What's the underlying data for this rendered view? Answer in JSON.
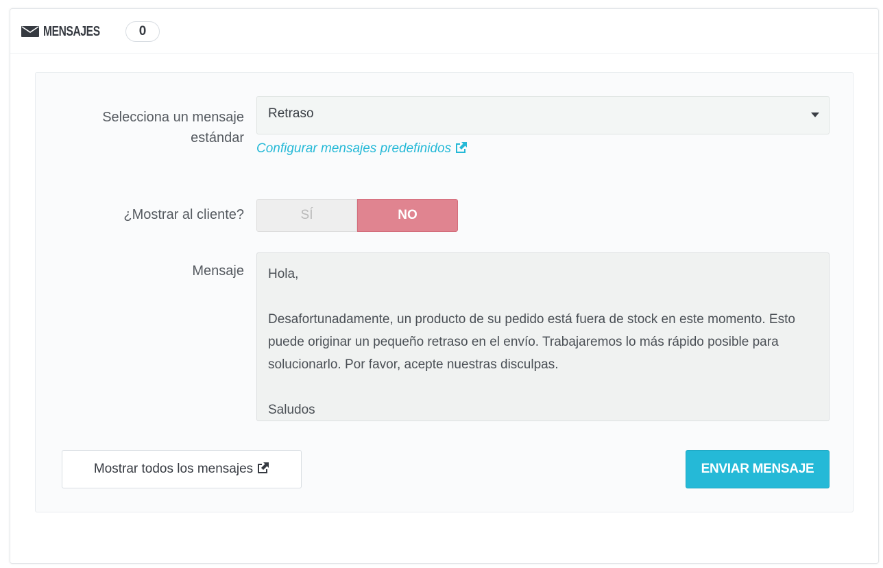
{
  "panel": {
    "title": "MENSAJES",
    "count": "0"
  },
  "form": {
    "select_label": "Selecciona un mensaje estándar",
    "select_value": "Retraso",
    "config_link": "Configurar mensajes predefinidos",
    "show_label": "¿Mostrar al cliente?",
    "toggle_yes": "SÍ",
    "toggle_no": "NO",
    "toggle_selected": "NO",
    "message_label": "Mensaje",
    "message_text": "Hola,\n\nDesafortunadamente, un producto de su pedido está fuera de stock en este momento. Esto puede originar un pequeño retraso en el envío. Trabajaremos lo más rápido posible para solucionarlo. Por favor, acepte nuestras disculpas.\n\nSaludos"
  },
  "actions": {
    "show_all": "Mostrar todos los mensajes",
    "send": "ENVIAR MENSAJE"
  },
  "colors": {
    "accent": "#25b9d7",
    "toggle_no": "#e08490"
  },
  "icons": {
    "heading": "envelope-icon",
    "external": "external-link-icon"
  }
}
